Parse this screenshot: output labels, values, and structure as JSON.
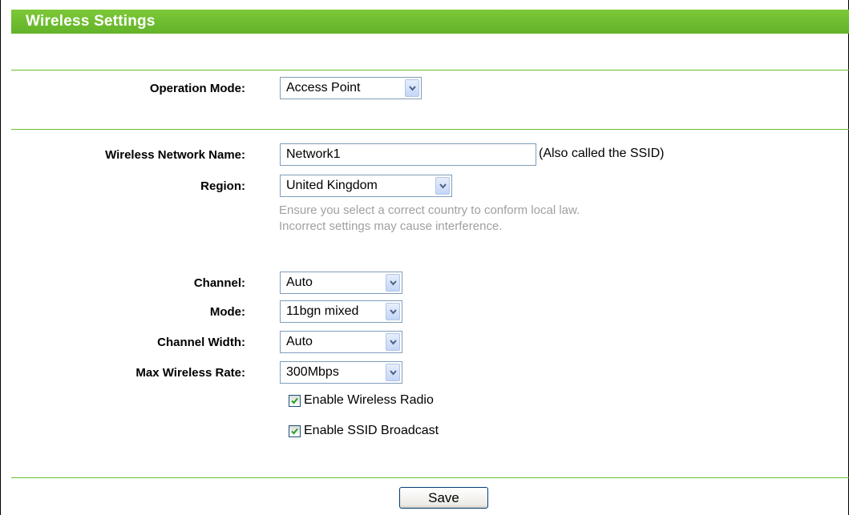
{
  "page": {
    "title": "Wireless Settings"
  },
  "operation_mode": {
    "label": "Operation Mode:",
    "value": "Access Point"
  },
  "network_name": {
    "label": "Wireless Network Name:",
    "value": "Network1",
    "note": "(Also called the SSID)"
  },
  "region": {
    "label": "Region:",
    "value": "United Kingdom",
    "hint_line1": "Ensure you select a correct country to conform local law.",
    "hint_line2": "Incorrect settings may cause interference."
  },
  "channel": {
    "label": "Channel:",
    "value": "Auto"
  },
  "mode": {
    "label": "Mode:",
    "value": "11bgn mixed"
  },
  "channel_width": {
    "label": "Channel Width:",
    "value": "Auto"
  },
  "max_rate": {
    "label": "Max Wireless Rate:",
    "value": "300Mbps"
  },
  "checkboxes": {
    "enable_radio": {
      "label": "Enable Wireless Radio",
      "checked": true
    },
    "enable_ssid_broadcast": {
      "label": "Enable SSID Broadcast",
      "checked": true
    }
  },
  "actions": {
    "save_label": "Save"
  },
  "colors": {
    "title_bar": "#6bbd2f",
    "title_text": "#ffffff",
    "divider": "#6bbd2f",
    "hint_text": "#a0a0a0"
  }
}
